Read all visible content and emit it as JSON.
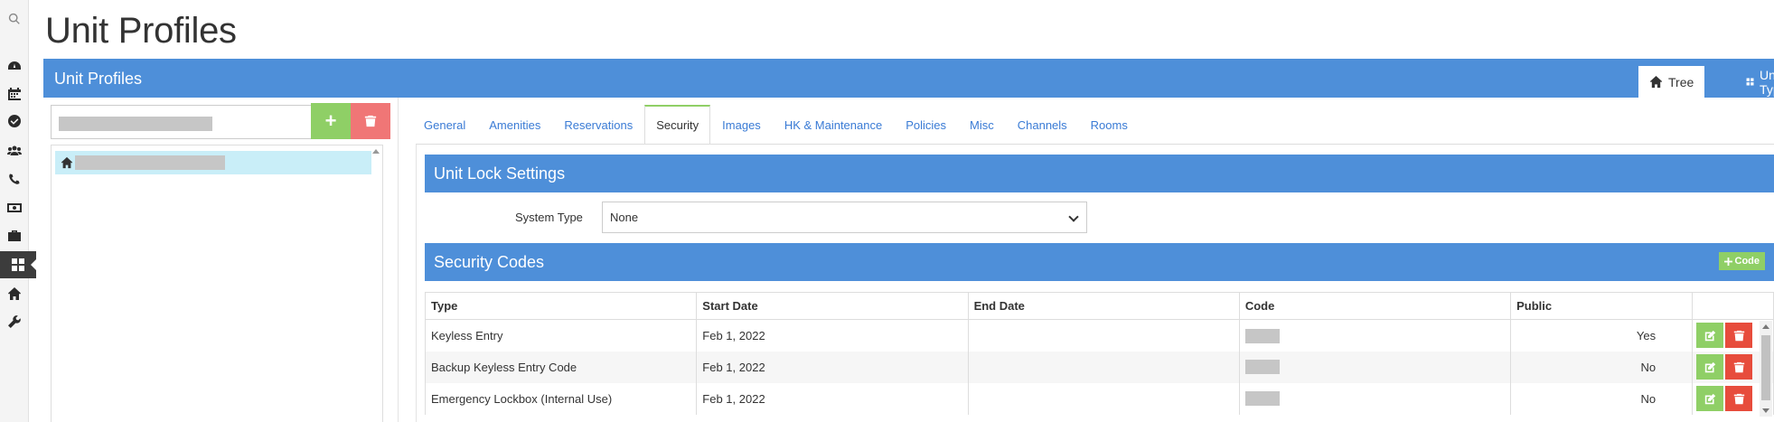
{
  "page": {
    "title": "Unit Profiles"
  },
  "header": {
    "title": "Unit Profiles",
    "views": [
      {
        "label": "Tree",
        "icon": "home-icon"
      },
      {
        "label": "Unit Typ",
        "icon": "grid-icon"
      }
    ]
  },
  "rail": {
    "items": [
      "search-icon",
      "dashboard-icon",
      "calendar-icon",
      "check-circle-icon",
      "users-icon",
      "phone-icon",
      "money-icon",
      "briefcase-icon",
      "grid-icon",
      "home-icon",
      "wrench-icon"
    ],
    "active": "grid-icon"
  },
  "tree": {
    "add_label": "+",
    "selected_node_icon": "home-icon"
  },
  "tabs": [
    {
      "label": "General"
    },
    {
      "label": "Amenities"
    },
    {
      "label": "Reservations"
    },
    {
      "label": "Security",
      "active": true
    },
    {
      "label": "Images"
    },
    {
      "label": "HK & Maintenance"
    },
    {
      "label": "Policies"
    },
    {
      "label": "Misc"
    },
    {
      "label": "Channels"
    },
    {
      "label": "Rooms"
    }
  ],
  "lock_settings": {
    "title": "Unit Lock Settings",
    "system_type_label": "System Type",
    "system_type_value": "None"
  },
  "security_codes": {
    "title": "Security Codes",
    "add_button": "Code",
    "columns": [
      "Type",
      "Start Date",
      "End Date",
      "Code",
      "Public"
    ],
    "rows": [
      {
        "type": "Keyless Entry",
        "start": "Feb 1, 2022",
        "end": "",
        "public": "Yes"
      },
      {
        "type": "Backup Keyless Entry Code",
        "start": "Feb 1, 2022",
        "end": "",
        "public": "No"
      },
      {
        "type": "Emergency Lockbox (Internal Use)",
        "start": "Feb 1, 2022",
        "end": "",
        "public": "No"
      }
    ]
  },
  "colors": {
    "primary_bar": "#4e8fd9",
    "success": "#8fcf66",
    "danger": "#e74c3c",
    "tab_active_border": "#8fcf66",
    "tree_selected": "#c9eef8"
  }
}
